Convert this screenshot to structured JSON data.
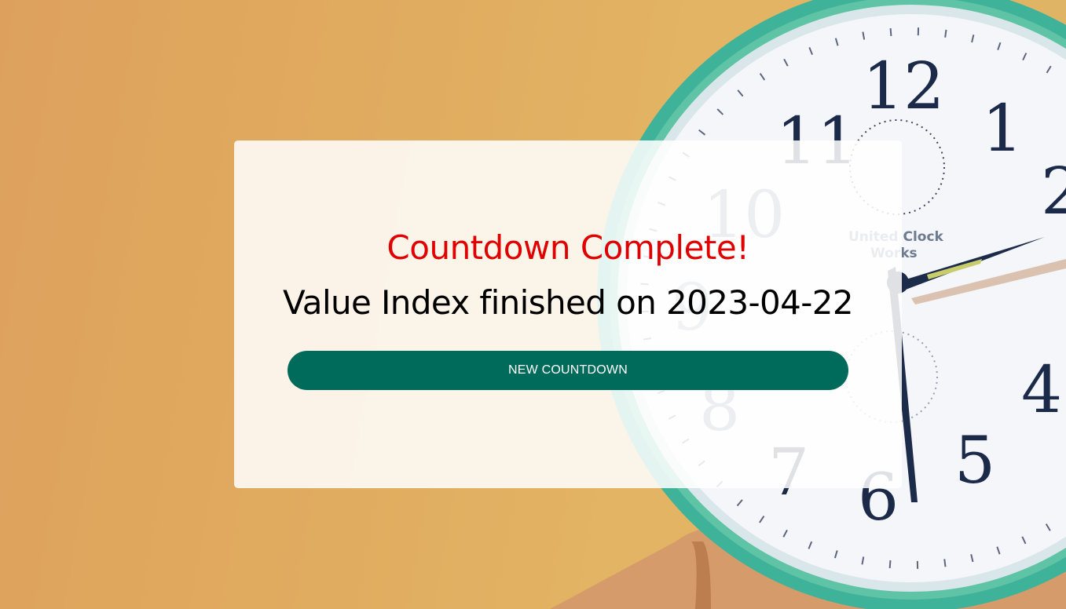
{
  "background": {
    "image": "alarm-clock",
    "clock_brand": "United Clock Works"
  },
  "card": {
    "title": "Countdown Complete!",
    "message": "Value Index finished on 2023-04-22",
    "button_label": "NEW COUNTDOWN"
  },
  "colors": {
    "title": "#e00000",
    "button": "#006b5a",
    "background": "#e0aa5f"
  }
}
